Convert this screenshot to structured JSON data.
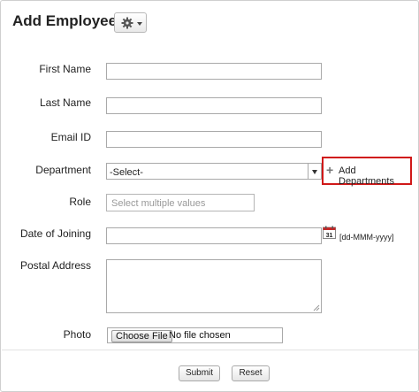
{
  "form": {
    "title": "Add Employee",
    "gear_menu_icon": "gear-icon"
  },
  "fields": {
    "first_name": {
      "label": "First Name",
      "value": ""
    },
    "last_name": {
      "label": "Last Name",
      "value": ""
    },
    "email": {
      "label": "Email ID",
      "value": ""
    },
    "department": {
      "label": "Department",
      "selected": "-Select-",
      "add_link": "Add Departments",
      "add_icon": "plus-icon"
    },
    "role": {
      "label": "Role",
      "placeholder": "Select multiple values"
    },
    "date_of_joining": {
      "label": "Date of Joining",
      "value": "",
      "format_hint": "[dd-MMM-yyyy]",
      "calendar_day": "31"
    },
    "postal_address": {
      "label": "Postal Address",
      "value": ""
    },
    "photo": {
      "label": "Photo",
      "button": "Choose File",
      "status": "No file chosen"
    }
  },
  "actions": {
    "submit": "Submit",
    "reset": "Reset"
  },
  "colors": {
    "highlight_border": "#d01919"
  }
}
